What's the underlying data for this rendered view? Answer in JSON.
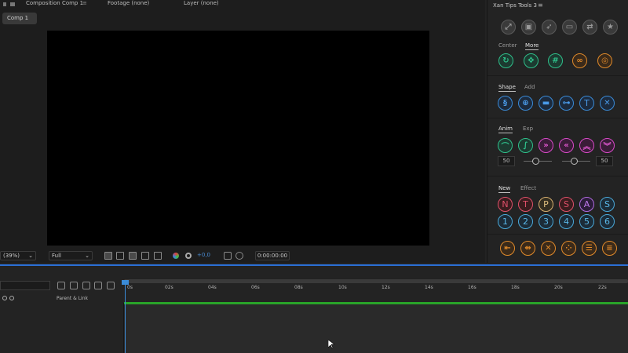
{
  "composition_panel": {
    "tabs": {
      "composition": "Composition Comp 1",
      "footage": "Footage (none)",
      "layer": "Layer (none)"
    },
    "comp_tab_label": "Comp 1",
    "toolbar": {
      "zoom": "(39%)",
      "resolution": "Full",
      "exposure": "+0,0",
      "timecode": "0:00:00:00"
    }
  },
  "tools_panel": {
    "title": "Xan Tips Tools 3",
    "top_icons": [
      "fullscreen-icon",
      "image-icon",
      "pin-icon",
      "folder-icon",
      "swap-icon",
      "star-icon"
    ],
    "sections": [
      {
        "tabs": [
          "Center",
          "More"
        ],
        "active": "More"
      },
      {
        "tabs": [
          "Shape",
          "Add"
        ],
        "active": "Shape"
      },
      {
        "tabs": [
          "Anim",
          "Exp"
        ],
        "active": "Anim"
      },
      {
        "tabs": [
          "New",
          "Effect"
        ],
        "active": "New"
      }
    ],
    "anim_value_left": "50",
    "anim_value_right": "50",
    "letters": [
      "N",
      "T",
      "P",
      "S",
      "A",
      "S"
    ],
    "numbers": [
      "1",
      "2",
      "3",
      "4",
      "5",
      "6"
    ]
  },
  "timeline": {
    "parent_link_label": "Parent & Link",
    "ticks": [
      "0s",
      "02s",
      "04s",
      "06s",
      "08s",
      "10s",
      "12s",
      "14s",
      "16s",
      "18s",
      "20s",
      "22s"
    ]
  },
  "colors": {
    "accent_blue": "#2b6fd6",
    "work_area_green": "#29a329"
  }
}
